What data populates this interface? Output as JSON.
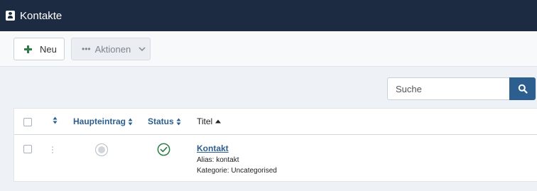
{
  "header": {
    "title": "Kontakte",
    "icon": "address-card-icon"
  },
  "toolbar": {
    "new_label": "Neu",
    "actions_label": "Aktionen"
  },
  "search": {
    "placeholder": "Suche"
  },
  "table": {
    "columns": {
      "featured": "Haupteintrag",
      "status": "Status",
      "title": "Titel"
    },
    "rows": [
      {
        "title": "Kontakt",
        "alias": "Alias: kontakt",
        "category": "Kategorie: Uncategorised",
        "featured": false,
        "published": true
      }
    ]
  },
  "colors": {
    "header_bg": "#1c2a42",
    "accent": "#2c5f8f",
    "success": "#2e7d46"
  }
}
